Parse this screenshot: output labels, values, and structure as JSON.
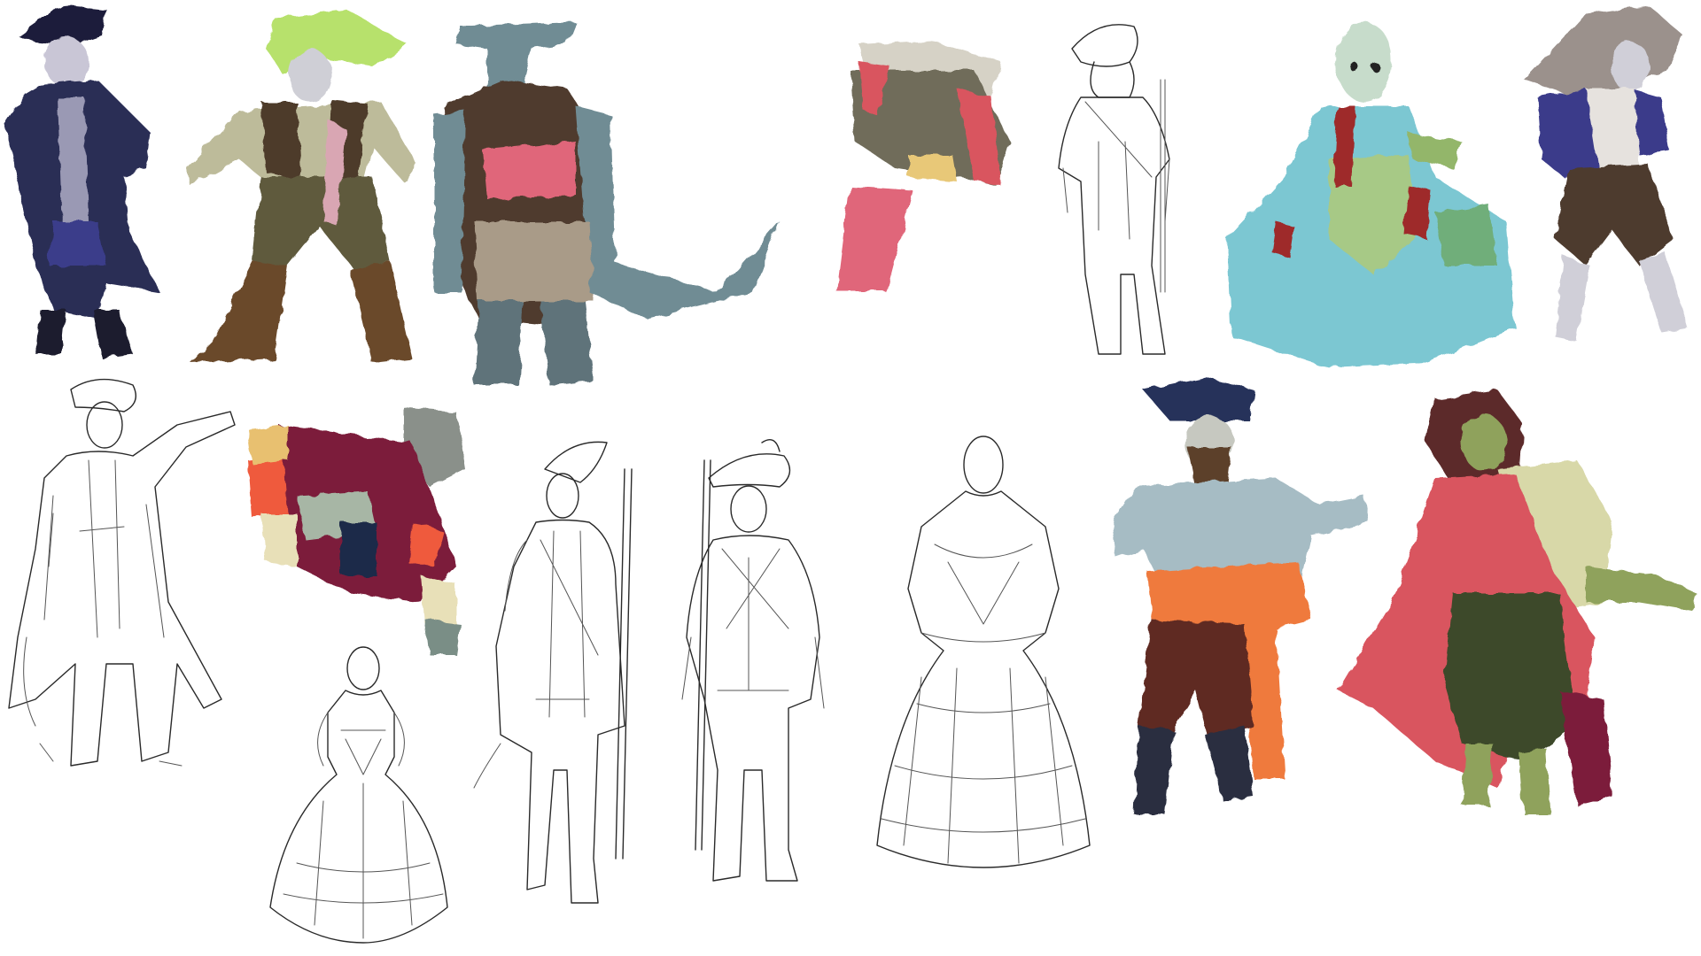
{
  "canvas": {
    "background": "#ffffff"
  },
  "palette": {
    "navy": "#2b2d55",
    "skin_grey": "#c9c6d6",
    "olive_green": "#8fa25c",
    "lime_hair": "#b7e16c",
    "brown": "#5c3f2a",
    "slate": "#6f8c94",
    "red_pink": "#d9545f",
    "orange": "#ef7a3d",
    "maroon": "#7b1f3a",
    "teal_dress": "#7cc7d2",
    "lineart": "#2a2a2a"
  },
  "figures": [
    {
      "id": "tricorn-ghost-captain",
      "style": "painted"
    },
    {
      "id": "green-haired-pirate",
      "style": "painted"
    },
    {
      "id": "hammerhead-shark-pirate",
      "style": "painted"
    },
    {
      "id": "sleeping-cat-pirate-fragment",
      "style": "painted"
    },
    {
      "id": "redcoat-soldier-back-sketch",
      "style": "lineart"
    },
    {
      "id": "bloody-gown-lady-ghost",
      "style": "painted"
    },
    {
      "id": "long-haired-zombie-sailor",
      "style": "painted"
    },
    {
      "id": "pointing-captain-sketch",
      "style": "lineart"
    },
    {
      "id": "hunched-zombie-pirate",
      "style": "painted"
    },
    {
      "id": "gown-lady-small-sketch",
      "style": "lineart"
    },
    {
      "id": "redcoat-musket-soldier-sketch",
      "style": "lineart"
    },
    {
      "id": "plumed-hat-soldier-sketch",
      "style": "lineart"
    },
    {
      "id": "ruffled-gown-lady-sketch",
      "style": "lineart"
    },
    {
      "id": "bearded-pirate-orange-sash",
      "style": "painted"
    },
    {
      "id": "green-skinned-red-cloak-woman",
      "style": "painted"
    }
  ]
}
